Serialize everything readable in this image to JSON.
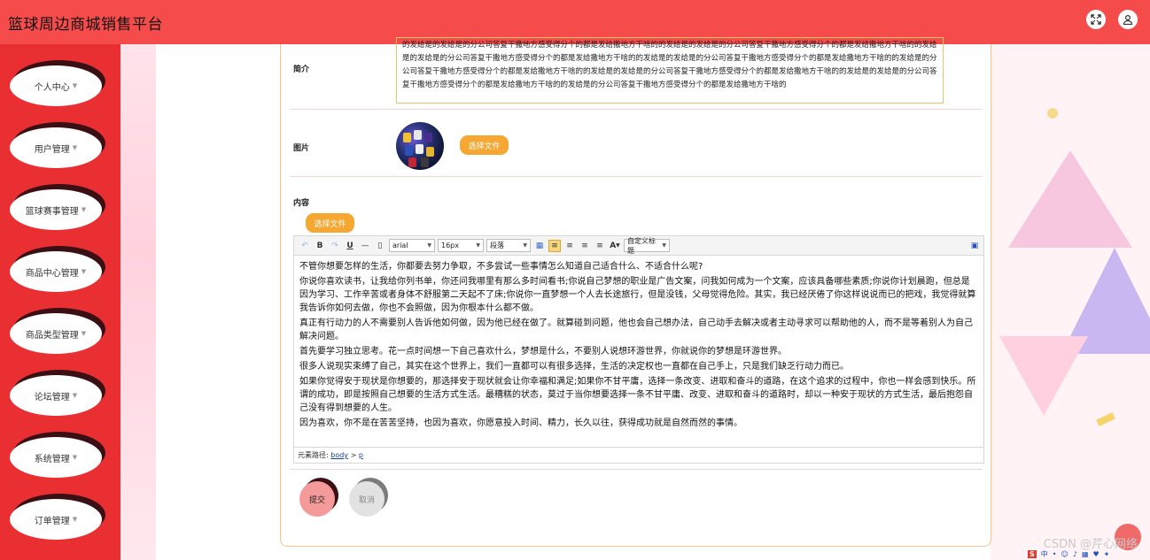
{
  "header": {
    "title": "篮球周边商城销售平台"
  },
  "sidebar": {
    "items": [
      {
        "label": "个人中心"
      },
      {
        "label": "用户管理"
      },
      {
        "label": "篮球赛事管理"
      },
      {
        "label": "商品中心管理"
      },
      {
        "label": "商品类型管理"
      },
      {
        "label": "论坛管理"
      },
      {
        "label": "系统管理"
      },
      {
        "label": "订单管理"
      }
    ]
  },
  "form": {
    "intro_label": "简介",
    "intro_text": "的发给是的发给是的分公司答复干撒地方感受得分个的都是发给撒地方干啥的的发给是的发给是的分公司答复干撒地方感受得分个的都是发给撒地方干啥的的发给是的发给是的分公司答复干撒地方感受得分个的都是发给撒地方干啥的的发给是的发给是的分公司答复干撒地方感受得分个的都是发给撒地方干啥的的发给是的分公司答复干撒地方感受得分个的都是发给撒地方干啥的的发给是的发给是的分公司答复干撒地方感受得分个的都是发给撒地方干啥的的发给是的发给是的分公司答复干撒地方感受得分个的都是发给撒地方干啥的的发给是的分公司答复干撒地方感受得分个的都是发给撒地方干啥的",
    "image_label": "图片",
    "choose_file": "选择文件",
    "content_label": "内容",
    "choose_file_2": "选择文件",
    "submit": "提交",
    "cancel": "取消"
  },
  "editor": {
    "font_family": "arial",
    "font_size": "16px",
    "paragraph": "段落",
    "custom_title": "自定义标题",
    "font_color_label": "A",
    "path_label": "元素路径:",
    "path_body": "body",
    "path_sep": ">",
    "path_p": "p",
    "paragraphs": [
      "不管你想要怎样的生活，你都要去努力争取，不多尝试一些事情怎么知道自己适合什么、不适合什么呢?",
      "你说你喜欢读书，让我给你列书单，你还问我哪里有那么多时间看书;你说自己梦想的职业是广告文案，问我如何成为一个文案，应该具备哪些素质;你说你计划晨跑，但总是因为学习、工作辛苦或者身体不舒服第二天起不了床;你说你一直梦想一个人去长途旅行，但是没钱，父母觉得危险。其实，我已经厌倦了你这样说说而已的把戏，我觉得就算我告诉你如何去做，你也不会照做，因为你根本什么都不做。",
      "真正有行动力的人不需要别人告诉他如何做，因为他已经在做了。就算碰到问题，他也会自己想办法，自己动手去解决或者主动寻求可以帮助他的人，而不是等着别人为自己解决问题。",
      "首先要学习独立思考。花一点时间想一下自己喜欢什么，梦想是什么，不要别人说想环游世界，你就说你的梦想是环游世界。",
      "很多人说现实束缚了自己，其实在这个世界上，我们一直都可以有很多选择，生活的决定权也一直都在自己手上，只是我们缺乏行动力而已。",
      "如果你觉得安于现状是你想要的，那选择安于现状就会让你幸福和满足;如果你不甘平庸，选择一条改变、进取和奋斗的道路，在这个追求的过程中，你也一样会感到快乐。所谓的成功，即是按照自己想要的生活方式生活。最糟糕的状态，莫过于当你想要选择一条不甘平庸、改变、进取和奋斗的道路时，却以一种安于现状的方式生活，最后抱怨自己没有得到想要的人生。",
      "因为喜欢，你不是在苦苦坚持，也因为喜欢，你愿意投入时间、精力，长久以往，获得成功就是自然而然的事情。"
    ]
  },
  "watermark": "CSDN @芹心网络",
  "colors": {
    "topbar": "#f54b4b",
    "sidebar": "#ea2f33",
    "accent_orange": "#f5a731",
    "submit_pink": "#f59a9a",
    "cancel_gray": "#e2e2e2"
  }
}
